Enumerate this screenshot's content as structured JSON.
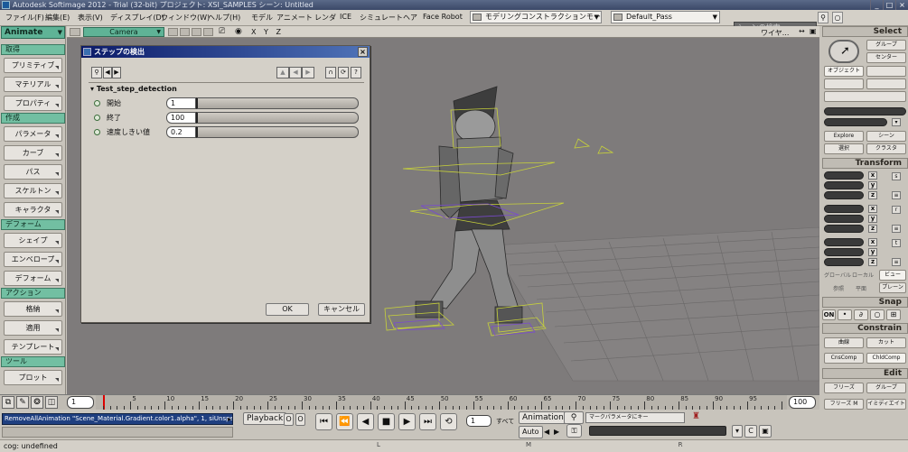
{
  "titlebar": {
    "text": "Autodesk Softimage 2012  - Trial (32-bit)     プロジェクト: XSI_SAMPLES     シーン: Untitled",
    "window_buttons": [
      "_",
      "□",
      "×"
    ]
  },
  "menubar": {
    "items": [
      "ファイル(F)",
      "編集(E)",
      "表示(V)",
      "ディスプレイ(D)",
      "ウィンドウ(W)",
      "ヘルプ(H)",
      "モデル",
      "アニメート",
      "レンダ",
      "ICE",
      "シミュレート",
      "ヘア",
      "Face Robot"
    ],
    "layout_mode": "モデリングコンストラクションモード",
    "render_pass": "Default_Pass",
    "search_placeholder": "シーンの検索"
  },
  "left_panel": {
    "mode": "Animate",
    "sections": [
      {
        "header": "取得",
        "buttons": [
          "プリミティブ",
          "マテリアル",
          "プロパティ"
        ]
      },
      {
        "header": "作成",
        "buttons": [
          "パラメータ",
          "カーブ",
          "パス",
          "スケルトン",
          "キャラクタ"
        ]
      },
      {
        "header": "デフォーム",
        "buttons": [
          "シェイプ",
          "エンベロープ",
          "デフォーム"
        ]
      },
      {
        "header": "アクション",
        "buttons": [
          "格納",
          "適用",
          "テンプレート"
        ]
      },
      {
        "header": "ツール",
        "buttons": [
          "プロット"
        ]
      }
    ]
  },
  "viewport": {
    "camera": "Camera",
    "xyz": "X Y Z",
    "display_mode": "ワイヤ..."
  },
  "dialog": {
    "title": "ステップの検出",
    "section": "Test_step_detection",
    "params": [
      {
        "label": "開始",
        "value": "1"
      },
      {
        "label": "終了",
        "value": "100"
      },
      {
        "label": "速度しきい値",
        "value": "0.2"
      }
    ],
    "ok": "OK",
    "cancel": "キャンセル"
  },
  "right_panel": {
    "select": {
      "header": "Select",
      "group": "グループ",
      "center": "センター",
      "object": "オブジェクト",
      "explore": "Explore",
      "scene": "シーン",
      "selection": "選択",
      "class": "クラスタ"
    },
    "transform": {
      "header": "Transform",
      "axes": [
        "x",
        "y",
        "z"
      ],
      "global": "グローバル",
      "local": "ローカル",
      "view": "ビュー",
      "ref": "参照",
      "plane": "平面",
      "frame": "プレーン"
    },
    "snap": {
      "header": "Snap",
      "on": "ON"
    },
    "constrain": {
      "header": "Constrain",
      "curve": "曲線",
      "cut": "カット",
      "cns_comp": "CnsComp",
      "child_comp": "ChldComp"
    },
    "edit": {
      "header": "Edit",
      "freeze": "フリーズ",
      "group": "グループ",
      "freeze_m": "フリーズ M",
      "immed": "イミディエイト"
    }
  },
  "timeline": {
    "start": "1",
    "end": "100",
    "current_frame": 1,
    "tick_labels": [
      "5",
      "10",
      "15",
      "20",
      "25",
      "30",
      "35",
      "40",
      "45",
      "50",
      "55",
      "60",
      "65",
      "70",
      "75",
      "80",
      "85",
      "90",
      "95"
    ]
  },
  "command": {
    "last": "RemoveAllAnimation \"Scene_Material.Gradient.color1.alpha\", 1, siUnspecified, siAnySource, siAllParam"
  },
  "playback": {
    "label": "Playback",
    "frame": "1",
    "all": "すべて",
    "animation_label": "Animation",
    "auto": "Auto",
    "marking": "マークパラメータにキー"
  },
  "status": {
    "text": "cog: undefined",
    "mouse": [
      "L",
      "M",
      "R"
    ]
  }
}
